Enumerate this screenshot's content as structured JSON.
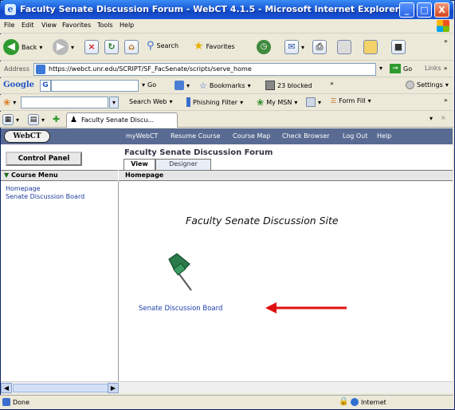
{
  "window": {
    "title": "Faculty Senate Discussion Forum - WebCT 4.1.5 - Microsoft Internet Explorer",
    "min_label": "_",
    "max_label": "□",
    "close_label": "X"
  },
  "menu": [
    "File",
    "Edit",
    "View",
    "Favorites",
    "Tools",
    "Help"
  ],
  "toolbar": {
    "back": "Back",
    "search": "Search",
    "favorites": "Favorites",
    "overflow": "»"
  },
  "address": {
    "label": "Address",
    "url": "https://webct.unr.edu/SCRIPT/SF_FacSenate/scripts/serve_home",
    "go": "Go",
    "links": "Links"
  },
  "google": {
    "logo": "Google",
    "go": "Go",
    "bookmarks": "Bookmarks",
    "blocked": "23 blocked",
    "settings": "Settings"
  },
  "linksbar": {
    "search_web": "Search Web",
    "phishing": "Phishing Filter",
    "msn": "My MSN",
    "form_fill": "Form Fill"
  },
  "tab": {
    "label": "Faculty Senate Discu..."
  },
  "webct": {
    "logo": "WebCT",
    "nav": [
      "myWebCT",
      "Resume Course",
      "Course Map",
      "Check Browser",
      "Log Out",
      "Help"
    ],
    "control_panel": "Control Panel",
    "forum_title": "Faculty Senate Discussion Forum",
    "tabs": [
      "View",
      "Designer Options"
    ],
    "course_menu": "Course Menu",
    "content_header": "Homepage",
    "sidebar_links": [
      "Homepage",
      "Senate Discussion Board"
    ],
    "site_title": "Faculty Senate Discussion Site",
    "board_link": "Senate Discussion Board"
  },
  "status": {
    "text": "Done",
    "zone": "Internet"
  },
  "colors": {
    "title_bar": "#1c5cd8",
    "webct_header": "#596b93",
    "arrow": "#e01010",
    "pushpin": "#2b7a4b"
  }
}
